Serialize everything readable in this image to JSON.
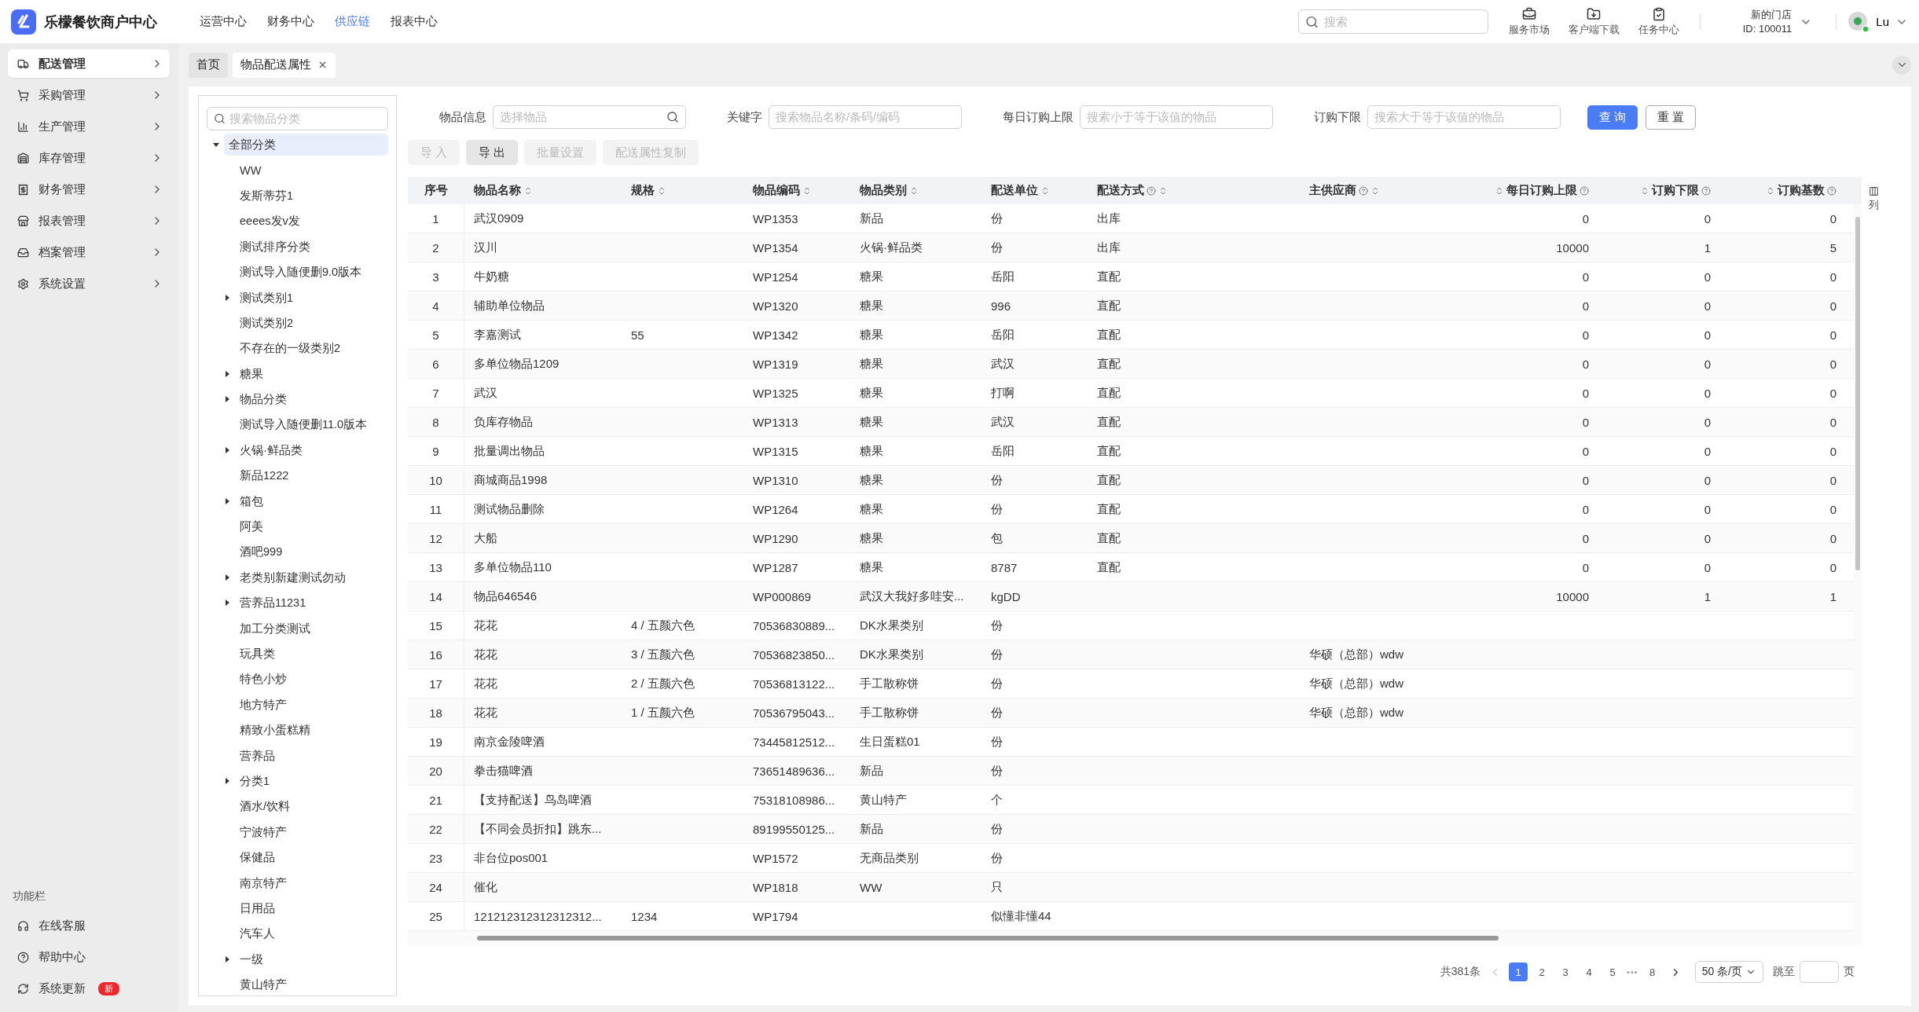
{
  "header": {
    "app_title": "乐檬餐饮商户中心",
    "nav": [
      {
        "label": "运营中心",
        "selected": false
      },
      {
        "label": "财务中心",
        "selected": false
      },
      {
        "label": "供应链",
        "selected": true
      },
      {
        "label": "报表中心",
        "selected": false
      }
    ],
    "search": {
      "placeholder": "搜索"
    },
    "tools": [
      {
        "kind": "market",
        "label": "服务市场"
      },
      {
        "kind": "download",
        "label": "客户端下载"
      },
      {
        "kind": "tasks",
        "label": "任务中心"
      }
    ],
    "store": {
      "name": "新的门店",
      "id": "ID: 100011"
    },
    "user": {
      "name": "Lu",
      "online": true
    }
  },
  "sidebar": {
    "items": [
      {
        "kind": "delivery",
        "label": "配送管理",
        "selected": true
      },
      {
        "kind": "purchase",
        "label": "采购管理",
        "selected": false
      },
      {
        "kind": "production",
        "label": "生产管理",
        "selected": false
      },
      {
        "kind": "stock",
        "label": "库存管理",
        "selected": false
      },
      {
        "kind": "finance",
        "label": "财务管理",
        "selected": false
      },
      {
        "kind": "report",
        "label": "报表管理",
        "selected": false
      },
      {
        "kind": "archive",
        "label": "档案管理",
        "selected": false
      },
      {
        "kind": "settings",
        "label": "系统设置",
        "selected": false
      }
    ],
    "footer_title": "功能栏",
    "footer_items": [
      {
        "kind": "support",
        "label": "在线客服"
      },
      {
        "kind": "help",
        "label": "帮助中心"
      },
      {
        "kind": "update",
        "label": "系统更新",
        "badge": "新"
      }
    ]
  },
  "tabs": [
    {
      "label": "首页",
      "selected": false,
      "closable": false
    },
    {
      "label": "物品配送属性",
      "selected": true,
      "closable": true
    }
  ],
  "tree": {
    "search": {
      "placeholder": "搜索物品分类"
    },
    "nodes": [
      {
        "label": "全部分类",
        "kind": "branch",
        "expanded": true,
        "selected": true,
        "children": [
          {
            "label": "WW",
            "kind": "leaf",
            "selected": false
          },
          {
            "label": "发斯蒂芬1",
            "kind": "leaf",
            "selected": false
          },
          {
            "label": "eeees发v发",
            "kind": "leaf",
            "selected": false
          },
          {
            "label": "测试排序分类",
            "kind": "leaf",
            "selected": false
          },
          {
            "label": "测试导入随便删9.0版本",
            "kind": "leaf",
            "selected": false
          },
          {
            "label": "测试类别1",
            "kind": "branch",
            "expanded": false,
            "selected": false
          },
          {
            "label": "测试类别2",
            "kind": "leaf",
            "selected": false
          },
          {
            "label": "不存在的一级类别2",
            "kind": "leaf",
            "selected": false
          },
          {
            "label": "糖果",
            "kind": "branch",
            "expanded": false,
            "selected": false
          },
          {
            "label": "物品分类",
            "kind": "branch",
            "expanded": false,
            "selected": false
          },
          {
            "label": "测试导入随便删11.0版本",
            "kind": "leaf",
            "selected": false
          },
          {
            "label": "火锅·鲜品类",
            "kind": "branch",
            "expanded": false,
            "selected": false
          },
          {
            "label": "新品1222",
            "kind": "leaf",
            "selected": false
          },
          {
            "label": "箱包",
            "kind": "branch",
            "expanded": false,
            "selected": false
          },
          {
            "label": "阿美",
            "kind": "leaf",
            "selected": false
          },
          {
            "label": "酒吧999",
            "kind": "leaf",
            "selected": false
          },
          {
            "label": "老类别新建测试勿动",
            "kind": "branch",
            "expanded": false,
            "selected": false
          },
          {
            "label": "营养品11231",
            "kind": "branch",
            "expanded": false,
            "selected": false
          },
          {
            "label": "加工分类测试",
            "kind": "leaf",
            "selected": false
          },
          {
            "label": "玩具类",
            "kind": "leaf",
            "selected": false
          },
          {
            "label": "特色小炒",
            "kind": "leaf",
            "selected": false
          },
          {
            "label": "地方特产",
            "kind": "leaf",
            "selected": false
          },
          {
            "label": "精致小蛋糕精",
            "kind": "leaf",
            "selected": false
          },
          {
            "label": "营养品",
            "kind": "leaf",
            "selected": false
          },
          {
            "label": "分类1",
            "kind": "branch",
            "expanded": false,
            "selected": false
          },
          {
            "label": "酒水/饮料",
            "kind": "leaf",
            "selected": false
          },
          {
            "label": "宁波特产",
            "kind": "leaf",
            "selected": false
          },
          {
            "label": "保健品",
            "kind": "leaf",
            "selected": false
          },
          {
            "label": "南京特产",
            "kind": "leaf",
            "selected": false
          },
          {
            "label": "日用品",
            "kind": "leaf",
            "selected": false
          },
          {
            "label": "汽车人",
            "kind": "leaf",
            "selected": false
          },
          {
            "label": "一级",
            "kind": "branch",
            "expanded": false,
            "selected": false
          },
          {
            "label": "黄山特产",
            "kind": "leaf",
            "selected": false
          }
        ]
      }
    ]
  },
  "filters": [
    {
      "kind": "picker",
      "label": "物品信息",
      "placeholder": "选择物品"
    },
    {
      "kind": "text",
      "label": "关键字",
      "placeholder": "搜索物品名称/条码/编码"
    },
    {
      "kind": "text",
      "label": "每日订购上限",
      "placeholder": "搜索小于等于该值的物品"
    },
    {
      "kind": "text",
      "label": "订购下限",
      "placeholder": "搜索大于等于该值的物品"
    }
  ],
  "filter_buttons": [
    {
      "kind": "primary",
      "label": "查 询"
    },
    {
      "kind": "default",
      "label": "重 置"
    }
  ],
  "toolbar": [
    {
      "label": "导 入",
      "disabled": true
    },
    {
      "label": "导 出",
      "disabled": false
    },
    {
      "label": "批量设置",
      "disabled": true
    },
    {
      "label": "配送属性复制",
      "disabled": true
    }
  ],
  "table": {
    "columns": [
      {
        "label": "序号",
        "sortable": false,
        "help": false
      },
      {
        "label": "物品名称",
        "sortable": true,
        "help": false
      },
      {
        "label": "规格",
        "sortable": true,
        "help": false
      },
      {
        "label": "物品编码",
        "sortable": true,
        "help": false
      },
      {
        "label": "物品类别",
        "sortable": true,
        "help": false
      },
      {
        "label": "配送单位",
        "sortable": true,
        "help": false
      },
      {
        "label": "配送方式",
        "sortable": true,
        "help": true
      },
      {
        "label": "主供应商",
        "sortable": true,
        "help": true
      },
      {
        "label": "每日订购上限",
        "sortable": true,
        "help": true
      },
      {
        "label": "订购下限",
        "sortable": true,
        "help": true
      },
      {
        "label": "订购基数",
        "sortable": true,
        "help": true
      }
    ],
    "column_settings": {
      "label": "列"
    },
    "rows": [
      [
        "1",
        "武汉0909",
        null,
        "WP1353",
        "新品",
        "份",
        "出库",
        null,
        "0",
        "0",
        "0"
      ],
      [
        "2",
        "汉川",
        null,
        "WP1354",
        "火锅·鲜品类",
        "份",
        "出库",
        null,
        "10000",
        "1",
        "5"
      ],
      [
        "3",
        "牛奶糖",
        null,
        "WP1254",
        "糖果",
        "岳阳",
        "直配",
        null,
        "0",
        "0",
        "0"
      ],
      [
        "4",
        "辅助单位物品",
        null,
        "WP1320",
        "糖果",
        "996",
        "直配",
        null,
        "0",
        "0",
        "0"
      ],
      [
        "5",
        "李嘉测试",
        "55",
        "WP1342",
        "糖果",
        "岳阳",
        "直配",
        null,
        "0",
        "0",
        "0"
      ],
      [
        "6",
        "多单位物品1209",
        null,
        "WP1319",
        "糖果",
        "武汉",
        "直配",
        null,
        "0",
        "0",
        "0"
      ],
      [
        "7",
        "武汉",
        null,
        "WP1325",
        "糖果",
        "打啊",
        "直配",
        null,
        "0",
        "0",
        "0"
      ],
      [
        "8",
        "负库存物品",
        null,
        "WP1313",
        "糖果",
        "武汉",
        "直配",
        null,
        "0",
        "0",
        "0"
      ],
      [
        "9",
        "批量调出物品",
        null,
        "WP1315",
        "糖果",
        "岳阳",
        "直配",
        null,
        "0",
        "0",
        "0"
      ],
      [
        "10",
        "商城商品1998",
        null,
        "WP1310",
        "糖果",
        "份",
        "直配",
        null,
        "0",
        "0",
        "0"
      ],
      [
        "11",
        "测试物品删除",
        null,
        "WP1264",
        "糖果",
        "份",
        "直配",
        null,
        "0",
        "0",
        "0"
      ],
      [
        "12",
        "大船",
        null,
        "WP1290",
        "糖果",
        "包",
        "直配",
        null,
        "0",
        "0",
        "0"
      ],
      [
        "13",
        "多单位物品110",
        null,
        "WP1287",
        "糖果",
        "8787",
        "直配",
        null,
        "0",
        "0",
        "0"
      ],
      [
        "14",
        "物品646546",
        null,
        "WP000869",
        "武汉大我好多哇安...",
        "kgDD",
        null,
        null,
        "10000",
        "1",
        "1"
      ],
      [
        "15",
        "花花",
        "4 / 五颜六色",
        "70536830889...",
        "DK水果类别",
        "份",
        null,
        null,
        null,
        null,
        null
      ],
      [
        "16",
        "花花",
        "3 / 五颜六色",
        "70536823850...",
        "DK水果类别",
        "份",
        null,
        "华硕（总部）wdw",
        null,
        null,
        null
      ],
      [
        "17",
        "花花",
        "2 / 五颜六色",
        "70536813122...",
        "手工散称饼",
        "份",
        null,
        "华硕（总部）wdw",
        null,
        null,
        null
      ],
      [
        "18",
        "花花",
        "1 / 五颜六色",
        "70536795043...",
        "手工散称饼",
        "份",
        null,
        "华硕（总部）wdw",
        null,
        null,
        null
      ],
      [
        "19",
        "南京金陵啤酒",
        null,
        "73445812512...",
        "生日蛋糕01",
        "份",
        null,
        null,
        null,
        null,
        null
      ],
      [
        "20",
        "拳击猫啤酒",
        null,
        "73651489636...",
        "新品",
        "份",
        null,
        null,
        null,
        null,
        null
      ],
      [
        "21",
        "【支持配送】鸟岛啤酒",
        null,
        "75318108986...",
        "黄山特产",
        "个",
        null,
        null,
        null,
        null,
        null
      ],
      [
        "22",
        "【不同会员折扣】跳东...",
        null,
        "89199550125...",
        "新品",
        "份",
        null,
        null,
        null,
        null,
        null
      ],
      [
        "23",
        "非台位pos001",
        null,
        "WP1572",
        "无商品类别",
        "份",
        null,
        null,
        null,
        null,
        null
      ],
      [
        "24",
        "催化",
        null,
        "WP1818",
        "WW",
        "只",
        null,
        null,
        null,
        null,
        null
      ],
      [
        "25",
        "121212312312312312...",
        "1234",
        "WP1794",
        null,
        "似懂非懂44",
        null,
        null,
        null,
        null,
        null
      ]
    ]
  },
  "pagination": {
    "total": "共381条",
    "prev_disabled": true,
    "next_disabled": false,
    "pages": [
      {
        "kind": "page",
        "label": "1",
        "selected": true
      },
      {
        "kind": "page",
        "label": "2",
        "selected": false
      },
      {
        "kind": "page",
        "label": "3",
        "selected": false
      },
      {
        "kind": "page",
        "label": "4",
        "selected": false
      },
      {
        "kind": "page",
        "label": "5",
        "selected": false
      },
      {
        "kind": "ellipsis",
        "label": "•••"
      },
      {
        "kind": "page",
        "label": "8",
        "selected": false
      }
    ],
    "page_size": "50 条/页",
    "jump_label": "跳至",
    "jump_suffix": "页"
  }
}
